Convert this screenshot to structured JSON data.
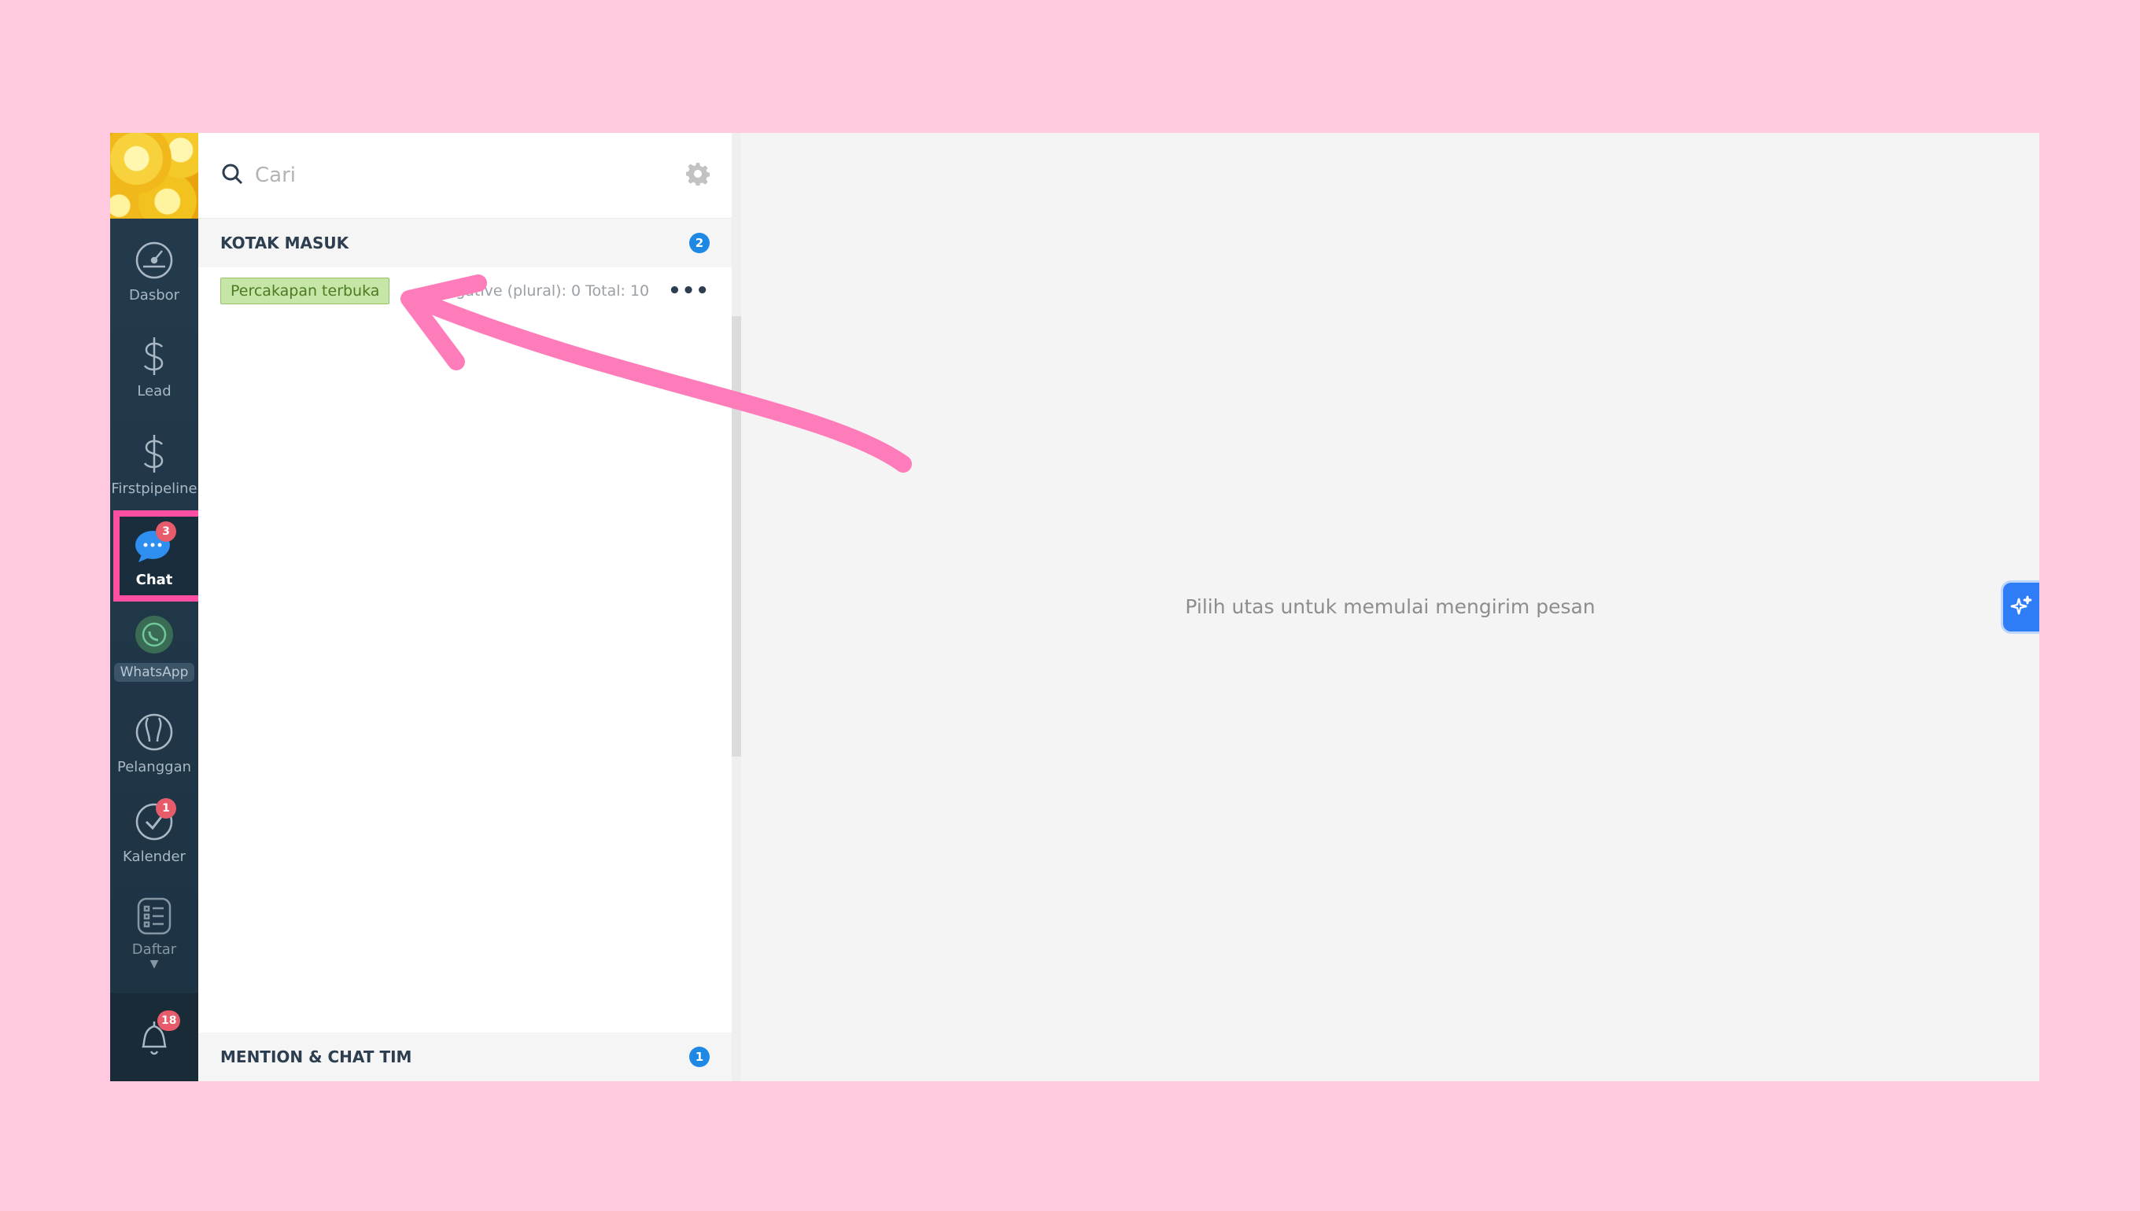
{
  "sidebar": {
    "items": [
      {
        "key": "dashboard",
        "label": "Dasbor"
      },
      {
        "key": "lead",
        "label": "Lead"
      },
      {
        "key": "firstpipeline",
        "label": "Firstpipeline"
      },
      {
        "key": "chat",
        "label": "Chat",
        "badge": "3"
      },
      {
        "key": "whatsapp",
        "label": "WhatsApp"
      },
      {
        "key": "customers",
        "label": "Pelanggan"
      },
      {
        "key": "calendar",
        "label": "Kalender",
        "badge": "1"
      },
      {
        "key": "list",
        "label": "Daftar"
      }
    ],
    "notifications_badge": "18"
  },
  "search": {
    "placeholder": "Cari"
  },
  "inbox": {
    "title": "KOTAK MASUK",
    "count": "2",
    "filter_tag": "Percakapan terbuka",
    "stats": "Negative (plural): 0   Total: 10"
  },
  "mentions": {
    "title": "MENTION & CHAT TIM",
    "count": "1"
  },
  "main": {
    "empty_message": "Pilih utas untuk memulai mengirim pesan"
  },
  "colors": {
    "page_background": "#ffc9e0",
    "highlight": "#ff4fa3",
    "arrow": "#ff7cba",
    "accent_blue": "#1e88e5"
  },
  "icons": [
    "search-icon",
    "gear-icon",
    "dashboard-icon",
    "dollar-icon",
    "chat-bubble-icon",
    "whatsapp-icon",
    "customers-icon",
    "checkmark-icon",
    "list-icon",
    "bell-icon",
    "sparkle-icon",
    "more-icon"
  ]
}
